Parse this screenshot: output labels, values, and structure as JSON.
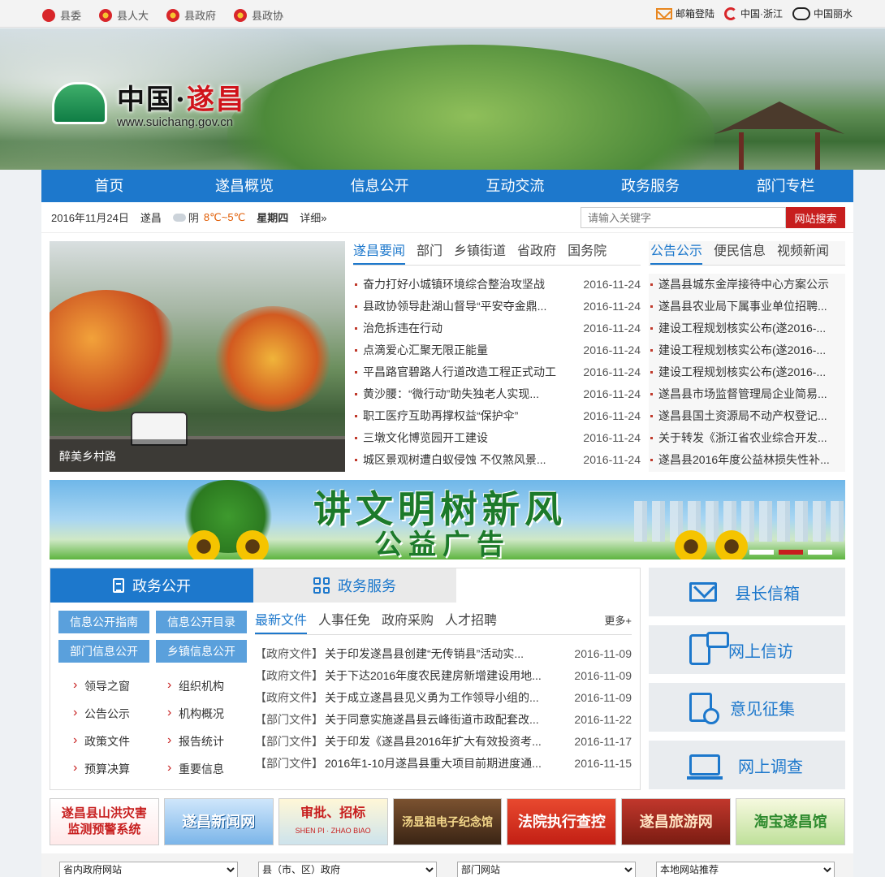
{
  "topbar": {
    "left_links": [
      {
        "label": "县委"
      },
      {
        "label": "县人大"
      },
      {
        "label": "县政府"
      },
      {
        "label": "县政协"
      }
    ],
    "right_links": [
      {
        "label": "邮箱登陆"
      },
      {
        "label": "中国·浙江"
      },
      {
        "label": "中国丽水"
      }
    ]
  },
  "banner": {
    "logo_prefix": "中国·",
    "logo_city": "遂昌",
    "logo_url": "www.suichang.gov.cn"
  },
  "nav": [
    "首页",
    "遂昌概览",
    "信息公开",
    "互动交流",
    "政务服务",
    "部门专栏"
  ],
  "infobar": {
    "date": "2016年11月24日",
    "city": "遂昌",
    "weather": "阴",
    "temp": "8℃~5℃",
    "weekday": "星期四",
    "detail": "详细»"
  },
  "search": {
    "placeholder": "请输入关键字",
    "button": "网站搜索"
  },
  "slider": {
    "caption": "醉美乡村路"
  },
  "news1": {
    "tabs": [
      "遂昌要闻",
      "部门",
      "乡镇街道",
      "省政府",
      "国务院"
    ],
    "items": [
      {
        "title": "奋力打好小城镇环境综合整治攻坚战",
        "date": "2016-11-24"
      },
      {
        "title": "县政协领导赴湖山督导“平安夺金鼎...",
        "date": "2016-11-24"
      },
      {
        "title": "治危拆违在行动",
        "date": "2016-11-24"
      },
      {
        "title": "点滴爱心汇聚无限正能量",
        "date": "2016-11-24"
      },
      {
        "title": "平昌路官碧路人行道改造工程正式动工",
        "date": "2016-11-24"
      },
      {
        "title": "黄沙腰：“微行动”助失独老人实现...",
        "date": "2016-11-24"
      },
      {
        "title": "职工医疗互助再撑权益“保护伞”",
        "date": "2016-11-24"
      },
      {
        "title": "三墩文化博览园开工建设",
        "date": "2016-11-24"
      },
      {
        "title": "城区景观树遭白蚁侵蚀 不仅煞风景...",
        "date": "2016-11-24"
      }
    ]
  },
  "news2": {
    "tabs": [
      "公告公示",
      "便民信息",
      "视频新闻"
    ],
    "items": [
      "遂昌县城东金岸接待中心方案公示",
      "遂昌县农业局下属事业单位招聘...",
      "建设工程规划核实公布(遂2016-...",
      "建设工程规划核实公布(遂2016-...",
      "建设工程规划核实公布(遂2016-...",
      "遂昌县市场监督管理局企业简易...",
      "遂昌县国土资源局不动产权登记...",
      "关于转发《浙江省农业综合开发...",
      "遂昌县2016年度公益林损失性补..."
    ]
  },
  "ad": {
    "line1": "讲文明树新风",
    "line2": "公益广告"
  },
  "govbox": {
    "tab_active": "政务公开",
    "tab_inactive": "政务服务",
    "buttons": [
      "信息公开指南",
      "信息公开目录",
      "部门信息公开",
      "乡镇信息公开"
    ],
    "links": [
      "领导之窗",
      "组织机构",
      "公告公示",
      "机构概况",
      "政策文件",
      "报告统计",
      "预算决算",
      "重要信息"
    ],
    "file_tabs": [
      "最新文件",
      "人事任免",
      "政府采购",
      "人才招聘"
    ],
    "more": "更多+",
    "files": [
      {
        "tag": "【政府文件】",
        "title": "关于印发遂昌县创建“无传销县”活动实...",
        "date": "2016-11-09"
      },
      {
        "tag": "【政府文件】",
        "title": "关于下达2016年度农民建房新增建设用地...",
        "date": "2016-11-09"
      },
      {
        "tag": "【政府文件】",
        "title": "关于成立遂昌县见义勇为工作领导小组的...",
        "date": "2016-11-09"
      },
      {
        "tag": "【部门文件】",
        "title": "关于同意实施遂昌县云峰街道市政配套改...",
        "date": "2016-11-22"
      },
      {
        "tag": "【部门文件】",
        "title": "关于印发《遂昌县2016年扩大有效投资考...",
        "date": "2016-11-17"
      },
      {
        "tag": "【部门文件】",
        "title": "2016年1-10月遂昌县重大项目前期进度通...",
        "date": "2016-11-15"
      }
    ]
  },
  "services": [
    "县长信箱",
    "网上信访",
    "意见征集",
    "网上调查"
  ],
  "link_banners": [
    {
      "l1": "遂昌县山洪灾害",
      "l2": "监测预警系统"
    },
    {
      "l1": "遂昌新闻网",
      "l2": ""
    },
    {
      "l1": "审批、招标",
      "l2": "SHEN PI · ZHAO BIAO"
    },
    {
      "l1": "汤显祖电子纪念馆",
      "l2": ""
    },
    {
      "l1": "法院执行查控",
      "l2": ""
    },
    {
      "l1": "遂昌旅游网",
      "l2": ""
    },
    {
      "l1": "淘宝遂昌馆",
      "l2": ""
    }
  ],
  "selects": [
    "省内政府网站",
    "县（市、区）政府",
    "部门网站",
    "本地网站推荐"
  ]
}
